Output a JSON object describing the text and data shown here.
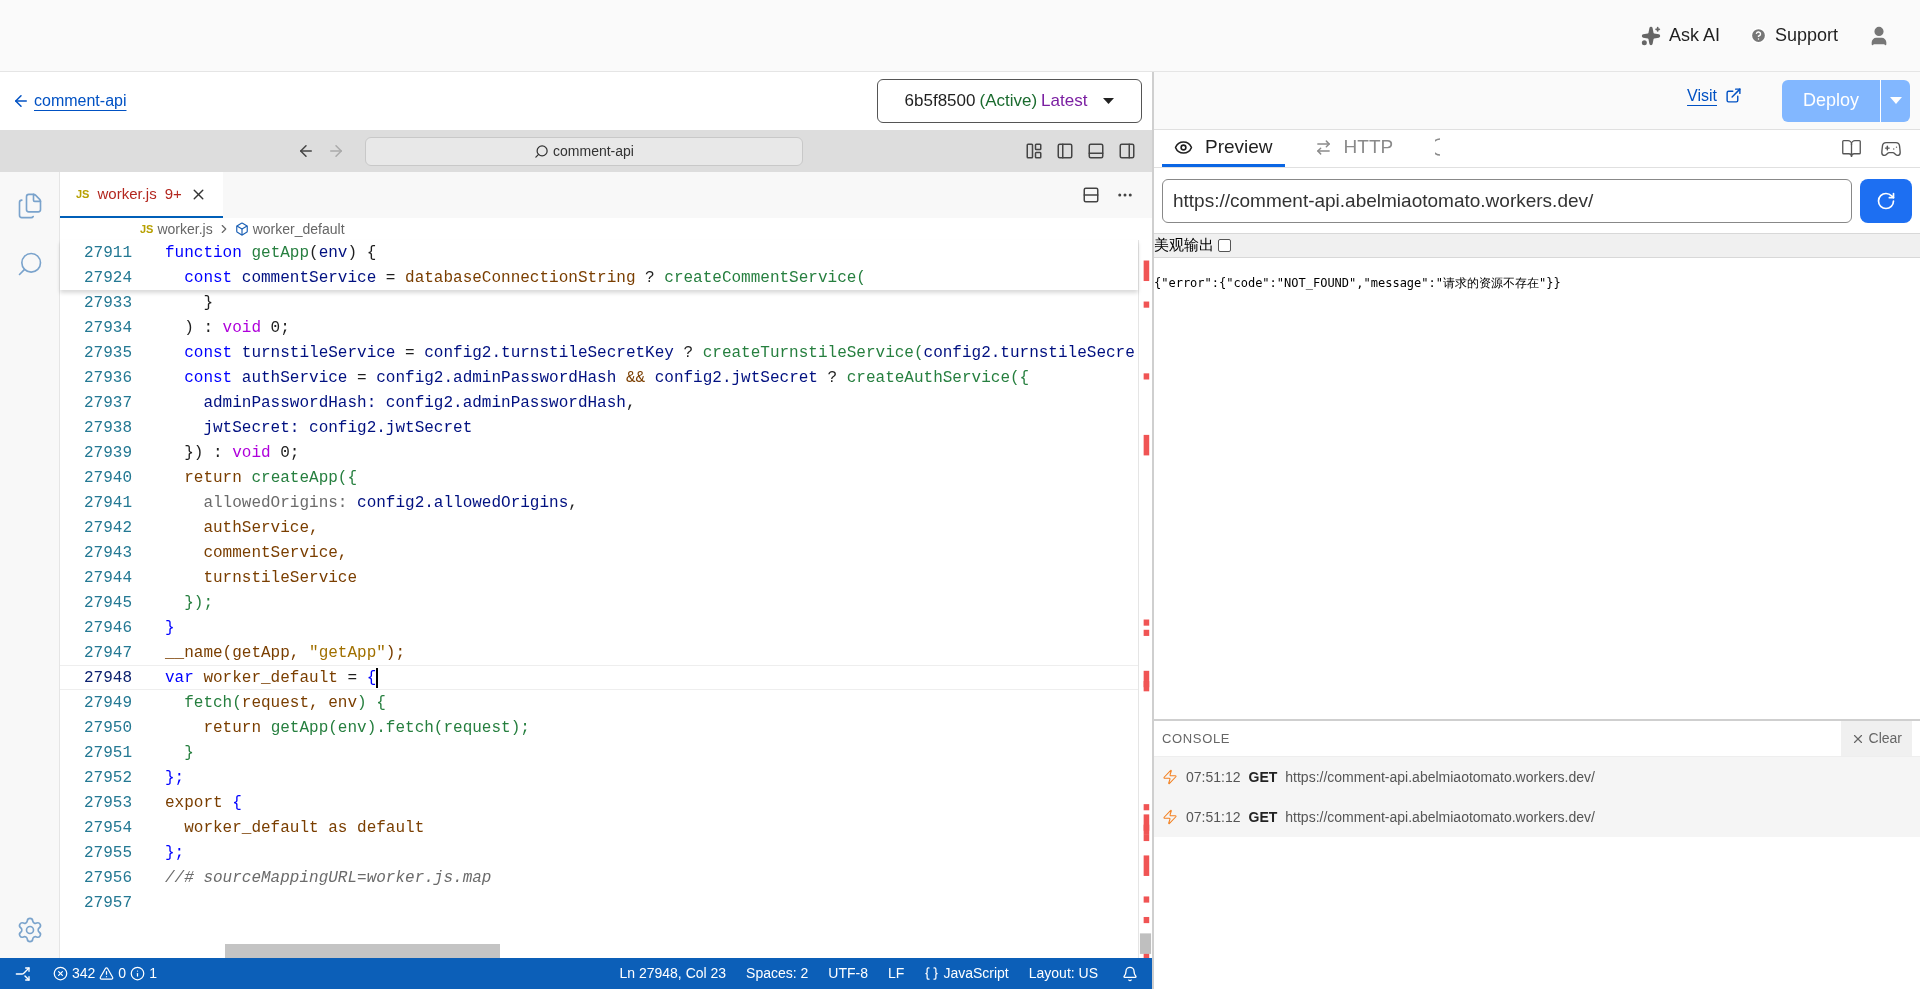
{
  "top_bar": {
    "ask_ai": "Ask AI",
    "support": "Support"
  },
  "worker_header": {
    "back_link": "comment-api",
    "version": {
      "id": "6b5f8500",
      "status": "(Active)",
      "tag": "Latest"
    }
  },
  "editor": {
    "title_search": "comment-api",
    "tab": {
      "lang": "JS",
      "file": "worker.js",
      "problems": "9+",
      "selected": true
    },
    "breadcrumb": {
      "lang": "JS",
      "file": "worker.js",
      "symbol": "worker_default"
    },
    "lines": [
      {
        "no": "27911",
        "sticky": true,
        "current": false,
        "tokens": [
          {
            "text": "function ",
            "kind": "k"
          },
          {
            "text": "getApp",
            "kind": "f"
          },
          {
            "text": "(",
            "kind": "d"
          },
          {
            "text": "env",
            "kind": "v"
          },
          {
            "text": ") {",
            "kind": "d"
          }
        ]
      },
      {
        "no": "27924",
        "sticky": true,
        "current": false,
        "tokens": [
          {
            "text": "  const ",
            "kind": "k"
          },
          {
            "text": "commentService",
            "kind": "v"
          },
          {
            "text": " = ",
            "kind": "d"
          },
          {
            "text": "databaseConnectionString",
            "kind": "b"
          },
          {
            "text": " ? ",
            "kind": "d"
          },
          {
            "text": "createCommentService(",
            "kind": "f"
          }
        ]
      },
      {
        "no": "27933",
        "sticky": false,
        "current": false,
        "tokens": [
          {
            "text": "    }",
            "kind": "d"
          }
        ]
      },
      {
        "no": "27934",
        "sticky": false,
        "current": false,
        "tokens": [
          {
            "text": "  ) : ",
            "kind": "d"
          },
          {
            "text": "void",
            "kind": "t"
          },
          {
            "text": " 0;",
            "kind": "d"
          }
        ]
      },
      {
        "no": "27935",
        "sticky": false,
        "current": false,
        "tokens": [
          {
            "text": "  const ",
            "kind": "k"
          },
          {
            "text": "turnstileService",
            "kind": "v"
          },
          {
            "text": " = ",
            "kind": "d"
          },
          {
            "text": "config2.turnstileSecretKey",
            "kind": "v"
          },
          {
            "text": " ? ",
            "kind": "d"
          },
          {
            "text": "createTurnstileService(",
            "kind": "f"
          },
          {
            "text": "config2.turnstileSecre",
            "kind": "v"
          }
        ]
      },
      {
        "no": "27936",
        "sticky": false,
        "current": false,
        "tokens": [
          {
            "text": "  const ",
            "kind": "k"
          },
          {
            "text": "authService",
            "kind": "v"
          },
          {
            "text": " = ",
            "kind": "d"
          },
          {
            "text": "config2.adminPasswordHash",
            "kind": "v"
          },
          {
            "text": " && ",
            "kind": "b"
          },
          {
            "text": "config2.jwtSecret",
            "kind": "v"
          },
          {
            "text": " ? ",
            "kind": "d"
          },
          {
            "text": "createAuthService({",
            "kind": "f"
          }
        ]
      },
      {
        "no": "27937",
        "sticky": false,
        "current": false,
        "tokens": [
          {
            "text": "    adminPasswordHash: ",
            "kind": "v"
          },
          {
            "text": "config2.adminPasswordHash",
            "kind": "v"
          },
          {
            "text": ",",
            "kind": "d"
          }
        ]
      },
      {
        "no": "27938",
        "sticky": false,
        "current": false,
        "tokens": [
          {
            "text": "    jwtSecret: ",
            "kind": "v"
          },
          {
            "text": "config2.jwtSecret",
            "kind": "v"
          }
        ]
      },
      {
        "no": "27939",
        "sticky": false,
        "current": false,
        "tokens": [
          {
            "text": "  }) : ",
            "kind": "d"
          },
          {
            "text": "void",
            "kind": "t"
          },
          {
            "text": " 0;",
            "kind": "d"
          }
        ]
      },
      {
        "no": "27940",
        "sticky": false,
        "current": false,
        "tokens": [
          {
            "text": "  return ",
            "kind": "b"
          },
          {
            "text": "createApp({",
            "kind": "f"
          }
        ]
      },
      {
        "no": "27941",
        "sticky": false,
        "current": false,
        "tokens": [
          {
            "text": "    allowedOrigins: ",
            "kind": "g"
          },
          {
            "text": "config2.allowedOrigins",
            "kind": "v"
          },
          {
            "text": ",",
            "kind": "d"
          }
        ]
      },
      {
        "no": "27942",
        "sticky": false,
        "current": false,
        "tokens": [
          {
            "text": "    authService,",
            "kind": "b"
          }
        ]
      },
      {
        "no": "27943",
        "sticky": false,
        "current": false,
        "tokens": [
          {
            "text": "    commentService,",
            "kind": "b"
          }
        ]
      },
      {
        "no": "27944",
        "sticky": false,
        "current": false,
        "tokens": [
          {
            "text": "    turnstileService",
            "kind": "b"
          }
        ]
      },
      {
        "no": "27945",
        "sticky": false,
        "current": false,
        "tokens": [
          {
            "text": "  });",
            "kind": "f"
          }
        ]
      },
      {
        "no": "27946",
        "sticky": false,
        "current": false,
        "tokens": [
          {
            "text": "}",
            "kind": "k"
          }
        ]
      },
      {
        "no": "27947",
        "sticky": false,
        "current": false,
        "tokens": [
          {
            "text": "__name(getApp, ",
            "kind": "b"
          },
          {
            "text": "\"getApp\"",
            "kind": "s"
          },
          {
            "text": ");",
            "kind": "b"
          }
        ]
      },
      {
        "no": "27948",
        "sticky": false,
        "current": true,
        "tokens": [
          {
            "text": "var ",
            "kind": "k"
          },
          {
            "text": "worker_default",
            "kind": "b"
          },
          {
            "text": " = ",
            "kind": "d"
          },
          {
            "text": "{",
            "kind": "k"
          }
        ]
      },
      {
        "no": "27949",
        "sticky": false,
        "current": false,
        "tokens": [
          {
            "text": "  fetch(",
            "kind": "f"
          },
          {
            "text": "request, env",
            "kind": "b"
          },
          {
            "text": ") {",
            "kind": "f"
          }
        ]
      },
      {
        "no": "27950",
        "sticky": false,
        "current": false,
        "tokens": [
          {
            "text": "    return ",
            "kind": "b"
          },
          {
            "text": "getApp(env).fetch(request);",
            "kind": "f"
          }
        ]
      },
      {
        "no": "27951",
        "sticky": false,
        "current": false,
        "tokens": [
          {
            "text": "  }",
            "kind": "f"
          }
        ]
      },
      {
        "no": "27952",
        "sticky": false,
        "current": false,
        "tokens": [
          {
            "text": "};",
            "kind": "k"
          }
        ]
      },
      {
        "no": "27953",
        "sticky": false,
        "current": false,
        "tokens": [
          {
            "text": "export ",
            "kind": "b"
          },
          {
            "text": "{",
            "kind": "k"
          }
        ]
      },
      {
        "no": "27954",
        "sticky": false,
        "current": false,
        "tokens": [
          {
            "text": "  worker_default as default",
            "kind": "b"
          }
        ]
      },
      {
        "no": "27955",
        "sticky": false,
        "current": false,
        "tokens": [
          {
            "text": "};",
            "kind": "k"
          }
        ]
      },
      {
        "no": "27956",
        "sticky": false,
        "current": false,
        "tokens": [
          {
            "text": "//# sourceMappingURL=worker.js.map",
            "kind": "c"
          }
        ]
      },
      {
        "no": "27957",
        "sticky": false,
        "current": false
      }
    ]
  },
  "status_bar": {
    "errors": "342",
    "warnings": "0",
    "infos": "1",
    "items": [
      {
        "kind": "text",
        "label": "Ln 27948, Col 23"
      },
      {
        "kind": "text",
        "label": "Spaces: 2"
      },
      {
        "kind": "text",
        "label": "UTF-8"
      },
      {
        "kind": "text",
        "label": "LF"
      },
      {
        "kind": "language",
        "label": "JavaScript"
      },
      {
        "kind": "text",
        "label": "Layout: US"
      }
    ]
  },
  "preview": {
    "visit": "Visit",
    "deploy": {
      "label": "Deploy",
      "disabled": true
    },
    "tabs": [
      {
        "label": "Preview",
        "kind": "preview",
        "selected": true
      },
      {
        "label": "HTTP",
        "kind": "http",
        "selected": false
      },
      {
        "kind": "partial",
        "selected": false
      }
    ],
    "url": "https://comment-api.abelmiaotomato.workers.dev/",
    "pretty": {
      "label": "美观输出",
      "checked": false
    },
    "body": "{\"error\":{\"code\":\"NOT_FOUND\",\"message\":\"请求的资源不存在\"}}",
    "console": {
      "title": "CONSOLE",
      "clear": "Clear",
      "rows": [
        {
          "time": "07:51:12",
          "method": "GET",
          "url": "https://comment-api.abelmiaotomato.workers.dev/"
        },
        {
          "time": "07:51:12",
          "method": "GET",
          "url": "https://comment-api.abelmiaotomato.workers.dev/"
        }
      ]
    }
  }
}
